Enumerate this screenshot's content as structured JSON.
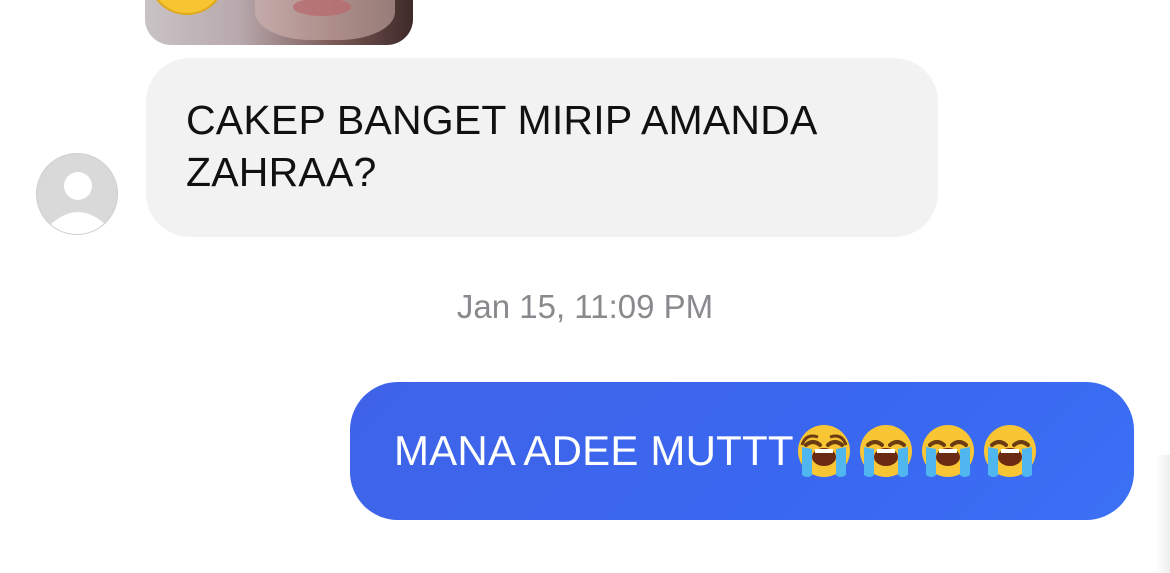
{
  "conversation": {
    "messages": [
      {
        "direction": "incoming",
        "type": "image",
        "overlay_emoji": "grinning-face-emoji"
      },
      {
        "direction": "incoming",
        "type": "text",
        "text": "CAKEP BANGET MIRIP AMANDA ZAHRAA?"
      }
    ],
    "timestamp": "Jan 15, 11:09 PM",
    "outgoing": {
      "text": "MANA ADEE MUTTT",
      "emojis": [
        "loudly-crying-face-emoji",
        "loudly-crying-face-emoji",
        "loudly-crying-face-emoji",
        "loudly-crying-face-emoji"
      ]
    }
  },
  "avatar": {
    "icon": "default-person-icon"
  },
  "colors": {
    "incoming_bubble": "#f2f2f2",
    "outgoing_bubble": "#3a67f0",
    "timestamp_text": "#8a8a8e",
    "avatar_bg": "#d9d9d9"
  }
}
